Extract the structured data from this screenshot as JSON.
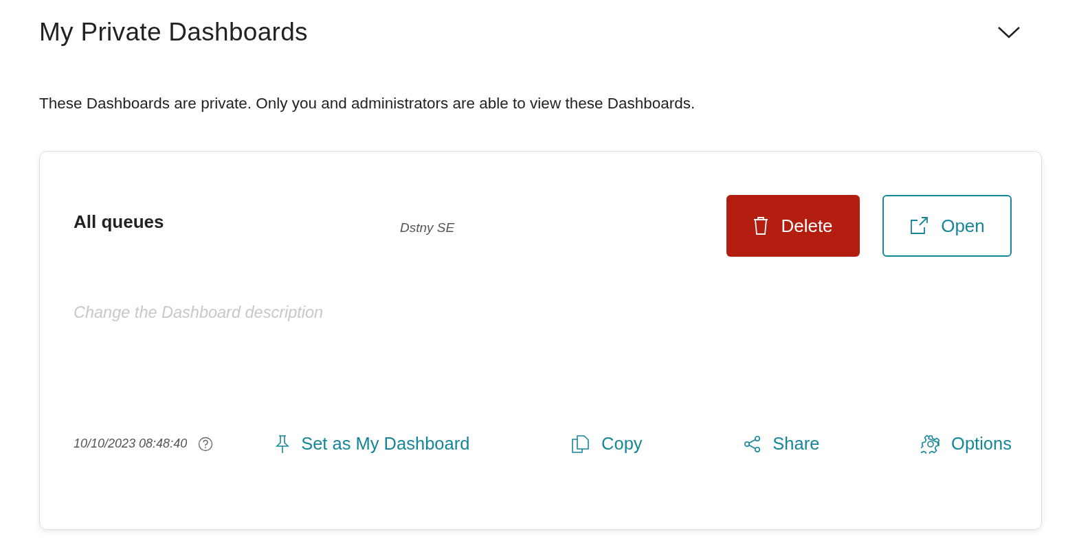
{
  "section": {
    "title": "My Private Dashboards",
    "note": "These Dashboards are private. Only you and administrators are able to view these Dashboards."
  },
  "dashboards": [
    {
      "name": "All queues",
      "owner": "Dstny SE",
      "buttons": [
        {
          "label": "Delete",
          "kind": "danger"
        },
        {
          "label": "Open",
          "kind": "outline"
        }
      ],
      "description": {
        "placeholder": "Change the Dashboard description"
      },
      "modified": "10/10/2023 08:48:40",
      "actions": [
        {
          "label": "Set as My Dashboard"
        },
        {
          "label": "Copy"
        },
        {
          "label": "Share"
        },
        {
          "label": "Options"
        }
      ]
    }
  ]
}
